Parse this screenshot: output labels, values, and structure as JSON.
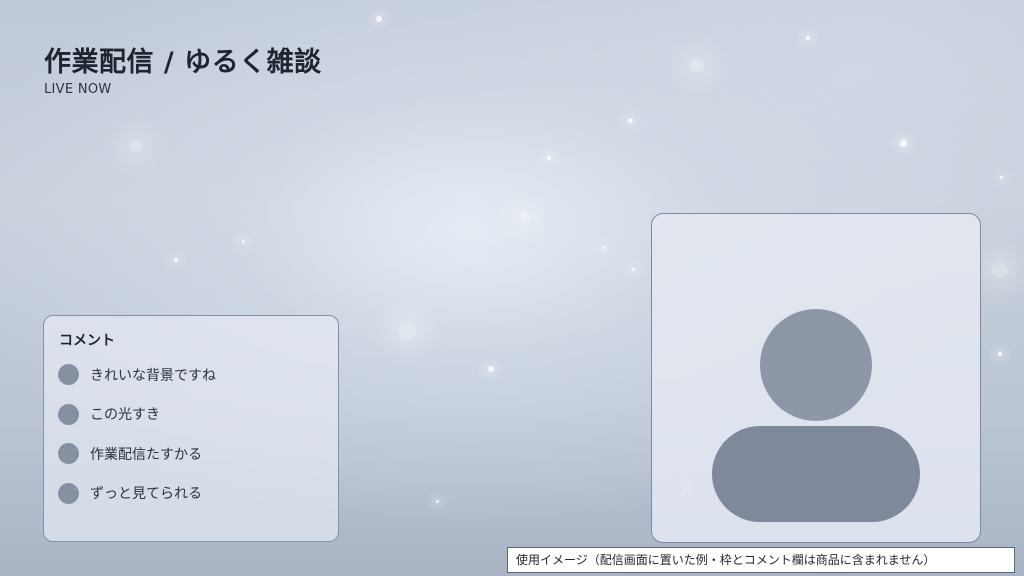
{
  "stream": {
    "title": "作業配信 / ゆるく雑談",
    "status": "LIVE NOW"
  },
  "comments": {
    "header": "コメント",
    "items": [
      {
        "text": "きれいな背景ですね"
      },
      {
        "text": "この光すき"
      },
      {
        "text": "作業配信たすかる"
      },
      {
        "text": "ずっと見てられる"
      }
    ]
  },
  "camera": {
    "icon": "person-silhouette-icon"
  },
  "caption": "使用イメージ（配信画面に置いた例・枠とコメント欄は商品に含まれません）",
  "colors": {
    "panel_border": "#8591a3",
    "avatar": "#8591a3",
    "silhouette": "#7e899b",
    "text": "#1f2530"
  }
}
